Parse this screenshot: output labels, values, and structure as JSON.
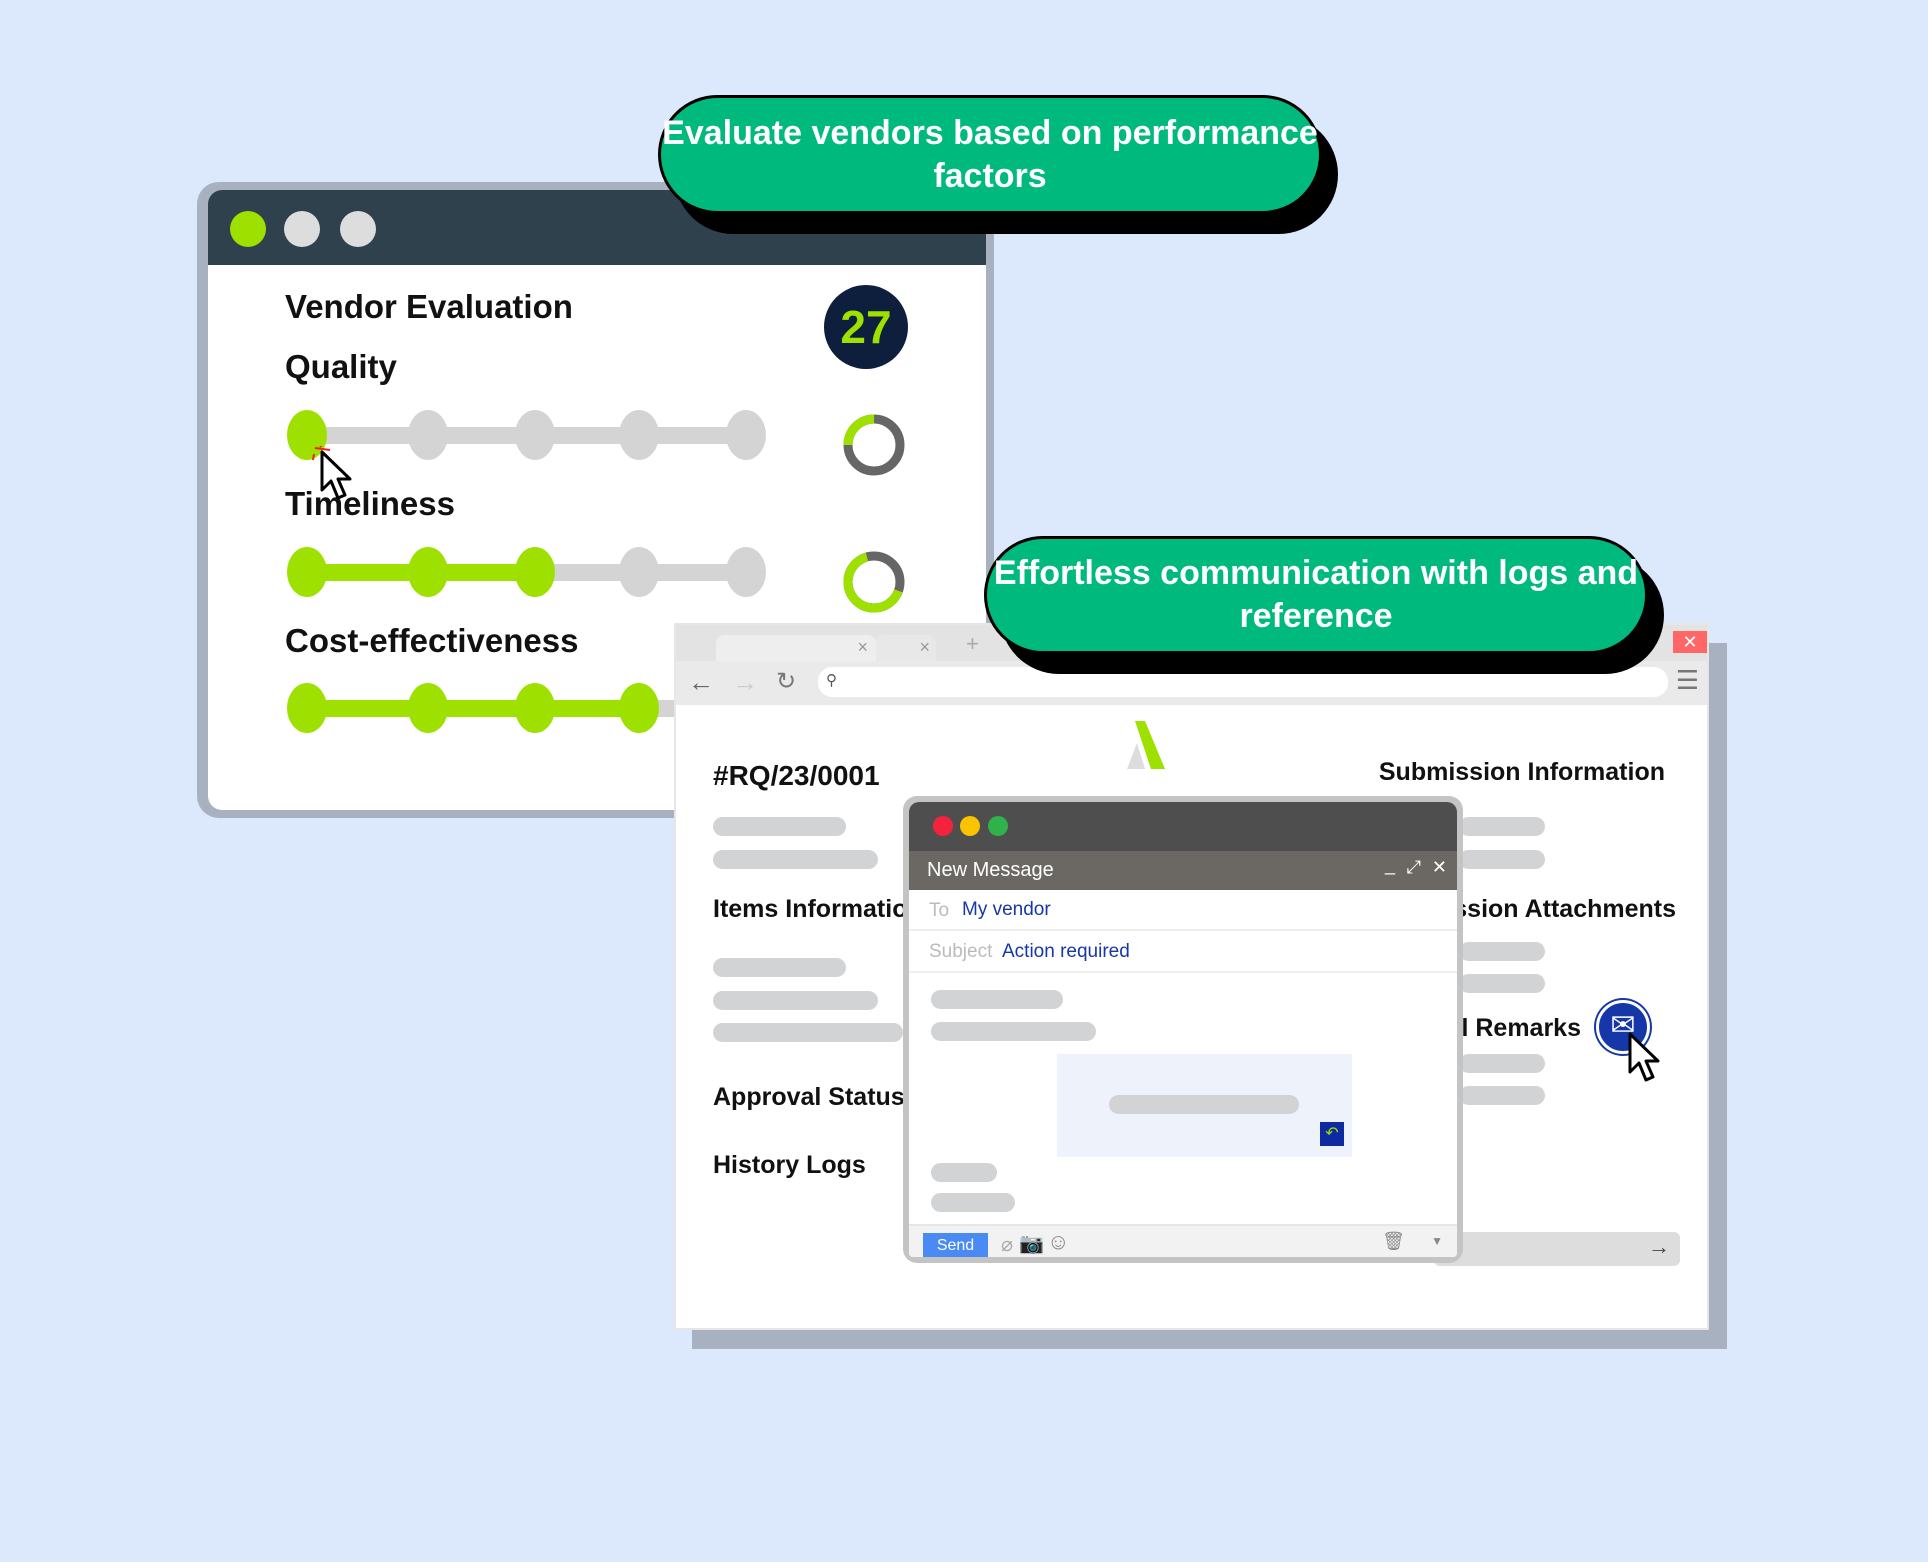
{
  "callouts": {
    "top": "Evaluate vendors based on performance factors",
    "middle": "Effortless communication with logs and reference"
  },
  "evaluation": {
    "title": "Vendor Evaluation",
    "score": "27",
    "criteria": [
      {
        "label": "Quality",
        "level": 1,
        "of": 5,
        "donut_percent": 25
      },
      {
        "label": "Timeliness",
        "level": 3,
        "of": 5,
        "donut_percent": 65
      },
      {
        "label": "Cost-effectiveness",
        "level": 4,
        "of": 5
      }
    ]
  },
  "browser": {
    "request_id": "#RQ/23/0001",
    "left_sections": [
      "Items Informatio",
      "Approval Status",
      "History Logs"
    ],
    "right_sections": [
      "Submission Information",
      "ssion Attachments",
      "al Remarks"
    ]
  },
  "compose": {
    "title": "New Message",
    "to_label": "To",
    "to_value": "My vendor",
    "subject_label": "Subject",
    "subject_value": "Action required",
    "send_label": "Send"
  },
  "colors": {
    "accent": "#9ee000",
    "callout": "#00b97c",
    "navy": "#0e1f3d",
    "send": "#4a8af4"
  }
}
